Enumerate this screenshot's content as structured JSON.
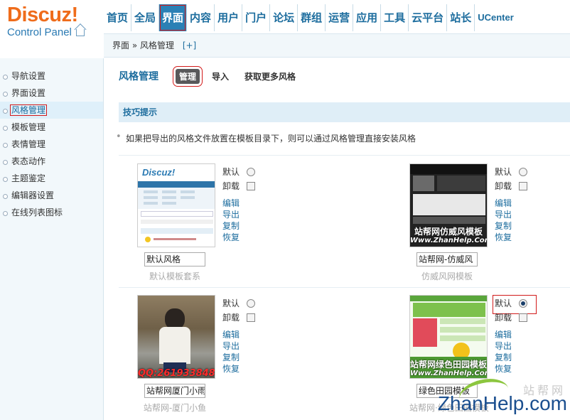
{
  "logo": {
    "main": "Discuz!",
    "sub": "Control Panel"
  },
  "nav": {
    "items": [
      "首页",
      "全局",
      "界面",
      "内容",
      "用户",
      "门户",
      "论坛",
      "群组",
      "运营",
      "应用",
      "工具",
      "云平台",
      "站长",
      "UCenter"
    ],
    "active_index": 2
  },
  "breadcrumb": {
    "text": "界面 » 风格管理",
    "add_label": "[+]"
  },
  "sidebar": {
    "items": [
      {
        "label": "导航设置"
      },
      {
        "label": "界面设置"
      },
      {
        "label": "风格管理"
      },
      {
        "label": "模板管理"
      },
      {
        "label": "表情管理"
      },
      {
        "label": "表态动作"
      },
      {
        "label": "主题鉴定"
      },
      {
        "label": "编辑器设置"
      },
      {
        "label": "在线列表图标"
      }
    ],
    "active_index": 2
  },
  "main": {
    "title": "风格管理",
    "tabs": [
      "管理",
      "导入",
      "获取更多风格"
    ],
    "tip_title": "技巧提示",
    "tip_text": "如果把导出的风格文件放置在模板目录下，则可以通过风格管理直接安装风格"
  },
  "option_labels": {
    "default": "默认",
    "uninstall": "卸载",
    "edit": "编辑",
    "export": "导出",
    "copy": "复制",
    "restore": "恢复"
  },
  "styles": [
    {
      "name_value": "默认风格",
      "subtitle": "默认模板套系",
      "is_default": false,
      "thumb": "discuz-default",
      "thumb_logo": "Discuz!"
    },
    {
      "name_value": "站帮网-仿威风",
      "subtitle": "仿威风网模板",
      "is_default": false,
      "thumb": "weifeng-dark",
      "thumb_caption": "站帮网仿威风模板",
      "thumb_url": "Www.ZhanHelp.Com"
    },
    {
      "name_value": "站帮网厦门小雨",
      "subtitle": "站帮网-厦门小鱼",
      "is_default": false,
      "thumb": "photo-man",
      "thumb_caption": "QQ:261933848"
    },
    {
      "name_value": "绿色田园模板",
      "subtitle": "站帮网·绿色田园模板",
      "is_default": true,
      "thumb": "green-garden",
      "thumb_caption": "站帮网绿色田园模板",
      "thumb_url": "Www.ZhanHelp.Com"
    }
  ],
  "watermark": {
    "cn": "站帮网",
    "en_a": "Zhan",
    "en_b": "Help",
    "en_c": ".com"
  },
  "colors": {
    "brand_orange": "#ef6c1b",
    "nav_blue": "#1d6d9e",
    "active_nav": "#2b80b5",
    "highlight_red": "#d21a1a"
  }
}
